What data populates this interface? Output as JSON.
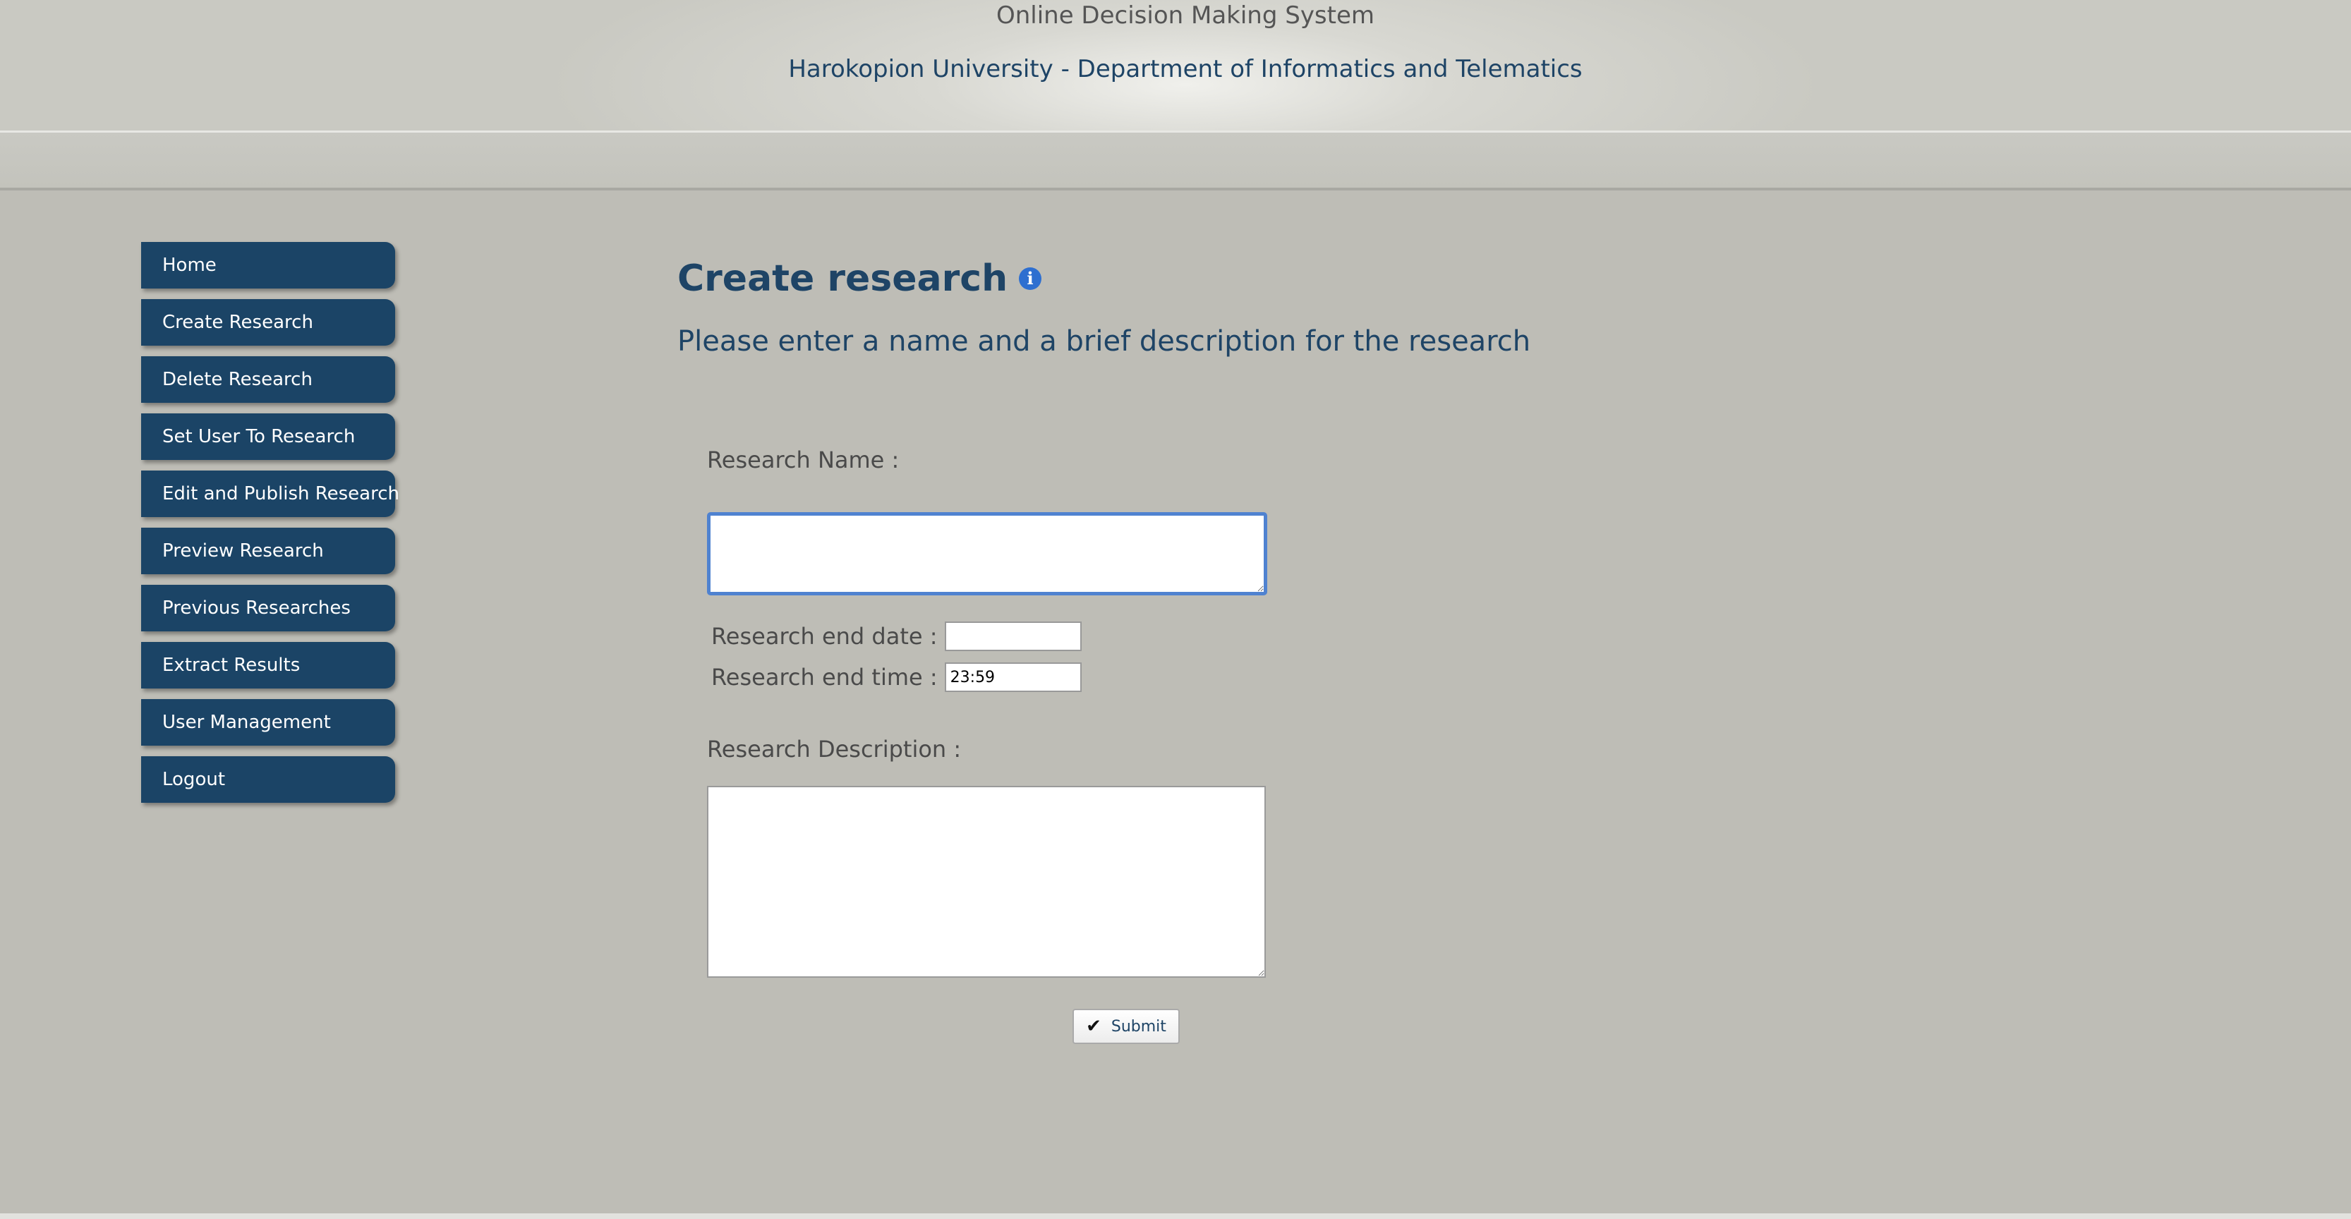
{
  "header": {
    "title": "Online Decision Making System",
    "subtitle": "Harokopion University - Department of Informatics and Telematics"
  },
  "sidebar": {
    "items": [
      {
        "label": "Home"
      },
      {
        "label": "Create Research"
      },
      {
        "label": "Delete Research"
      },
      {
        "label": "Set User To Research"
      },
      {
        "label": "Edit and Publish Research"
      },
      {
        "label": "Preview Research"
      },
      {
        "label": "Previous Researches"
      },
      {
        "label": "Extract Results"
      },
      {
        "label": "User Management"
      },
      {
        "label": "Logout"
      }
    ]
  },
  "main": {
    "title": "Create research",
    "info_icon": "info-icon",
    "instruction": "Please enter a name and a brief description for the research",
    "form": {
      "name_label": "Research Name :",
      "name_value": "",
      "end_date_label": "Research end date :",
      "end_date_value": "",
      "end_time_label": "Research end time :",
      "end_time_value": "23:59",
      "description_label": "Research Description :",
      "description_value": "",
      "submit_label": "Submit",
      "submit_icon": "check-icon"
    }
  },
  "colors": {
    "nav_bg": "#1b4466",
    "title_color": "#1e4466",
    "focus_border": "#4f82d0",
    "page_bg": "#bdbdb6"
  }
}
